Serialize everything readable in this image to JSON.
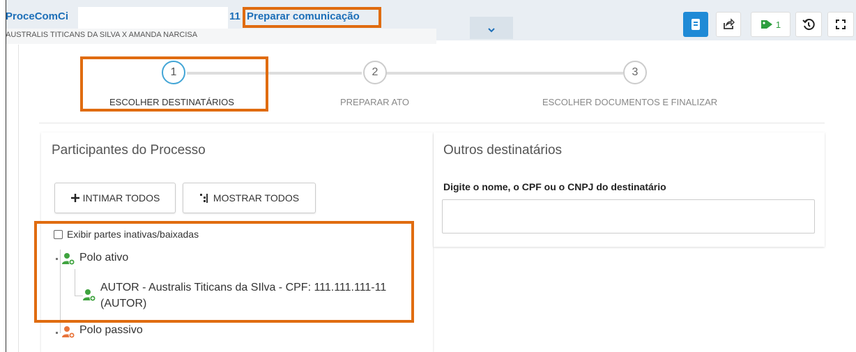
{
  "header": {
    "process_title": "ProceComCi",
    "process_suffix": "11",
    "task_title": "Preparar comunicação",
    "subtitle": "AUSTRALIS TITICANS DA SILVA X AMANDA NARCISA",
    "toolbar": {
      "tag_count": "1"
    }
  },
  "stepper": {
    "steps": [
      {
        "number": "1",
        "label": "ESCOLHER DESTINATÁRIOS"
      },
      {
        "number": "2",
        "label": "PREPARAR ATO"
      },
      {
        "number": "3",
        "label": "ESCOLHER DOCUMENTOS E FINALIZAR"
      }
    ]
  },
  "participants": {
    "title": "Participantes do Processo",
    "intimar_label": "INTIMAR TODOS",
    "mostrar_label": "MOSTRAR TODOS",
    "show_inactive_label": "Exibir partes inativas/baixadas",
    "polo_ativo": "Polo ativo",
    "autor_line1": "AUTOR - Australis Titicans da SIlva - CPF: 111.111.111-11",
    "autor_line2": "(AUTOR)",
    "polo_passivo": "Polo passivo"
  },
  "outros": {
    "title": "Outros destinatários",
    "field_label": "Digite o nome, o CPF ou o CNPJ do destinatário",
    "field_value": ""
  },
  "colors": {
    "brand_blue": "#1d6fb8",
    "highlight_orange": "#e06c10",
    "primary_button": "#1f8ad6",
    "tag_green": "#2e9e3f",
    "person_green": "#3fa33f",
    "person_orange": "#e8743b"
  },
  "icons": {
    "toolbar": [
      "book-icon",
      "share-icon",
      "tag-icon",
      "history-icon",
      "fullscreen-icon"
    ],
    "dropdown": "chevron-down-icon",
    "buttons": [
      "plus-icon",
      "hierarchy-icon"
    ],
    "tree": [
      "user-add-icon"
    ]
  }
}
